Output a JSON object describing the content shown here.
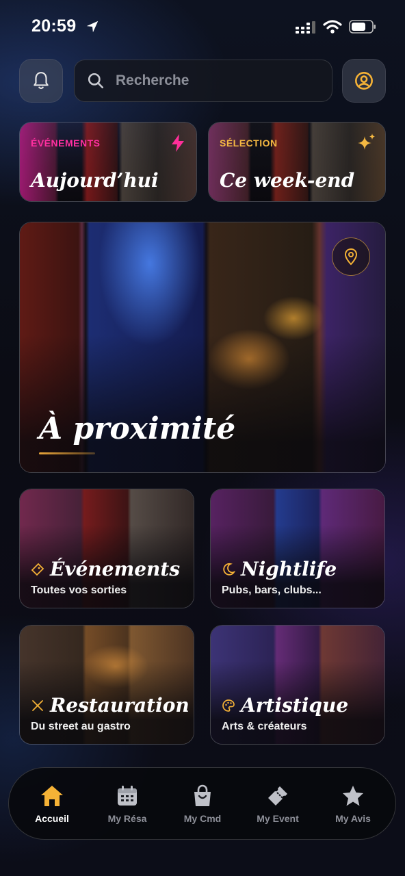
{
  "status_bar": {
    "time": "20:59"
  },
  "search": {
    "placeholder": "Recherche"
  },
  "quick_cards": [
    {
      "tag": "ÉVÉNEMENTS",
      "title": "Aujourd’hui",
      "tag_color": "#ff2fa0",
      "icon": "lightning-icon"
    },
    {
      "tag": "SÉLECTION",
      "title": "Ce week-end",
      "tag_color": "#f5b942",
      "icon": "sparkles-icon"
    }
  ],
  "hero": {
    "title": "À proximité",
    "icon": "map-pin-icon"
  },
  "categories": [
    {
      "title": "Événements",
      "subtitle": "Toutes vos sorties",
      "icon": "ticket-icon"
    },
    {
      "title": "Nightlife",
      "subtitle": "Pubs, bars, clubs...",
      "icon": "moon-icon"
    },
    {
      "title": "Restauration",
      "subtitle": "Du street au gastro",
      "icon": "utensils-icon"
    },
    {
      "title": "Artistique",
      "subtitle": "Arts & créateurs",
      "icon": "palette-icon"
    }
  ],
  "nav": {
    "items": [
      {
        "label": "Accueil",
        "icon": "home-icon",
        "active": true
      },
      {
        "label": "My Résa",
        "icon": "calendar-icon",
        "active": false
      },
      {
        "label": "My Cmd",
        "icon": "shopping-bag-icon",
        "active": false
      },
      {
        "label": "My Event",
        "icon": "ticket-icon",
        "active": false
      },
      {
        "label": "My Avis",
        "icon": "star-icon",
        "active": false
      }
    ]
  },
  "colors": {
    "accent": "#f5b236",
    "background": "#0b0c12"
  }
}
